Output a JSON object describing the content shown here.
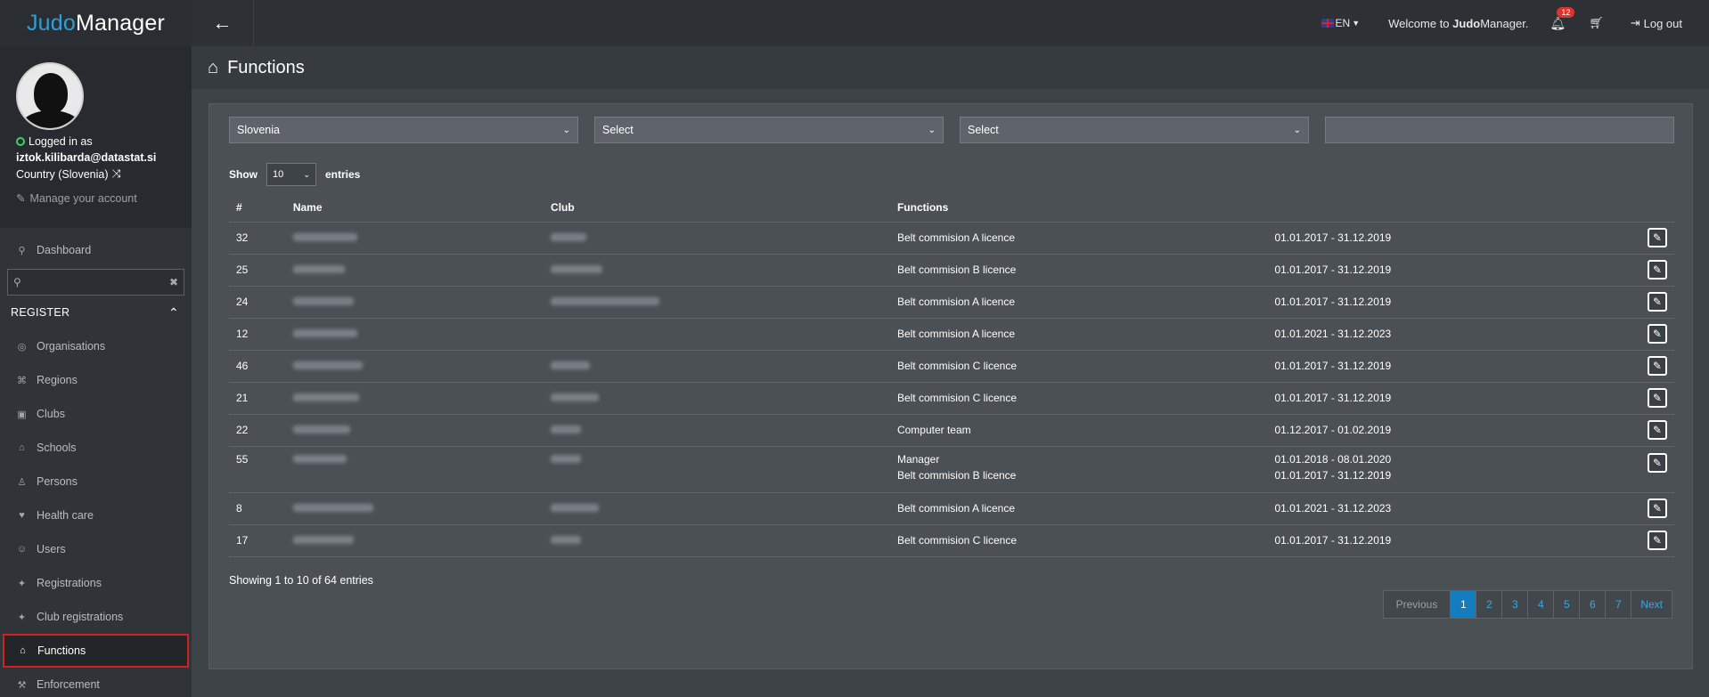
{
  "brand": {
    "part1": "Judo",
    "part2": "Manager"
  },
  "profile": {
    "logged_label": "Logged in as",
    "email": "iztok.kilibarda@datastat.si",
    "country": "Country (Slovenia)",
    "manage": "Manage your account"
  },
  "sidebar": {
    "dashboard": "Dashboard",
    "register_label": "REGISTER",
    "items": [
      {
        "label": "Organisations",
        "icon": "globe-icon"
      },
      {
        "label": "Regions",
        "icon": "map-icon"
      },
      {
        "label": "Clubs",
        "icon": "building-icon"
      },
      {
        "label": "Schools",
        "icon": "graduation-cap-icon"
      },
      {
        "label": "Persons",
        "icon": "user-icon"
      },
      {
        "label": "Health care",
        "icon": "heart-icon"
      },
      {
        "label": "Users",
        "icon": "users-icon"
      },
      {
        "label": "Registrations",
        "icon": "pin-icon"
      },
      {
        "label": "Club registrations",
        "icon": "pin-icon"
      },
      {
        "label": "Functions",
        "icon": "graduation-cap-icon"
      },
      {
        "label": "Enforcement",
        "icon": "gavel-icon"
      }
    ]
  },
  "topbar": {
    "lang": "EN",
    "welcome_pre": "Welcome to ",
    "welcome_bold": "Judo",
    "welcome_post": "Manager.",
    "notifications": "12",
    "logout": "Log out"
  },
  "page": {
    "title": "Functions"
  },
  "filters": {
    "country": "Slovenia",
    "select1": "Select",
    "select2": "Select",
    "search": ""
  },
  "table": {
    "show_label": "Show",
    "length": "10",
    "entries_label": "entries",
    "headers": {
      "num": "#",
      "name": "Name",
      "club": "Club",
      "functions": "Functions"
    },
    "rows": [
      {
        "num": "32",
        "functions": [
          "Belt commision A licence"
        ],
        "dates": [
          "01.01.2017 - 31.12.2019"
        ]
      },
      {
        "num": "25",
        "functions": [
          "Belt commision B licence"
        ],
        "dates": [
          "01.01.2017 - 31.12.2019"
        ]
      },
      {
        "num": "24",
        "functions": [
          "Belt commision A licence"
        ],
        "dates": [
          "01.01.2017 - 31.12.2019"
        ]
      },
      {
        "num": "12",
        "functions": [
          "Belt commision A licence"
        ],
        "dates": [
          "01.01.2021 - 31.12.2023"
        ]
      },
      {
        "num": "46",
        "functions": [
          "Belt commision C licence"
        ],
        "dates": [
          "01.01.2017 - 31.12.2019"
        ]
      },
      {
        "num": "21",
        "functions": [
          "Belt commision C licence"
        ],
        "dates": [
          "01.01.2017 - 31.12.2019"
        ]
      },
      {
        "num": "22",
        "functions": [
          "Computer team"
        ],
        "dates": [
          "01.12.2017 - 01.02.2019"
        ]
      },
      {
        "num": "55",
        "functions": [
          "Manager",
          "Belt commision B licence"
        ],
        "dates": [
          "01.01.2018 - 08.01.2020",
          "01.01.2017 - 31.12.2019"
        ]
      },
      {
        "num": "8",
        "functions": [
          "Belt commision A licence"
        ],
        "dates": [
          "01.01.2021 - 31.12.2023"
        ]
      },
      {
        "num": "17",
        "functions": [
          "Belt commision C licence"
        ],
        "dates": [
          "01.01.2017 - 31.12.2019"
        ]
      }
    ],
    "info": "Showing 1 to 10 of 64 entries"
  },
  "pagination": {
    "previous": "Previous",
    "pages": [
      "1",
      "2",
      "3",
      "4",
      "5",
      "6",
      "7"
    ],
    "next": "Next",
    "current": "1"
  }
}
